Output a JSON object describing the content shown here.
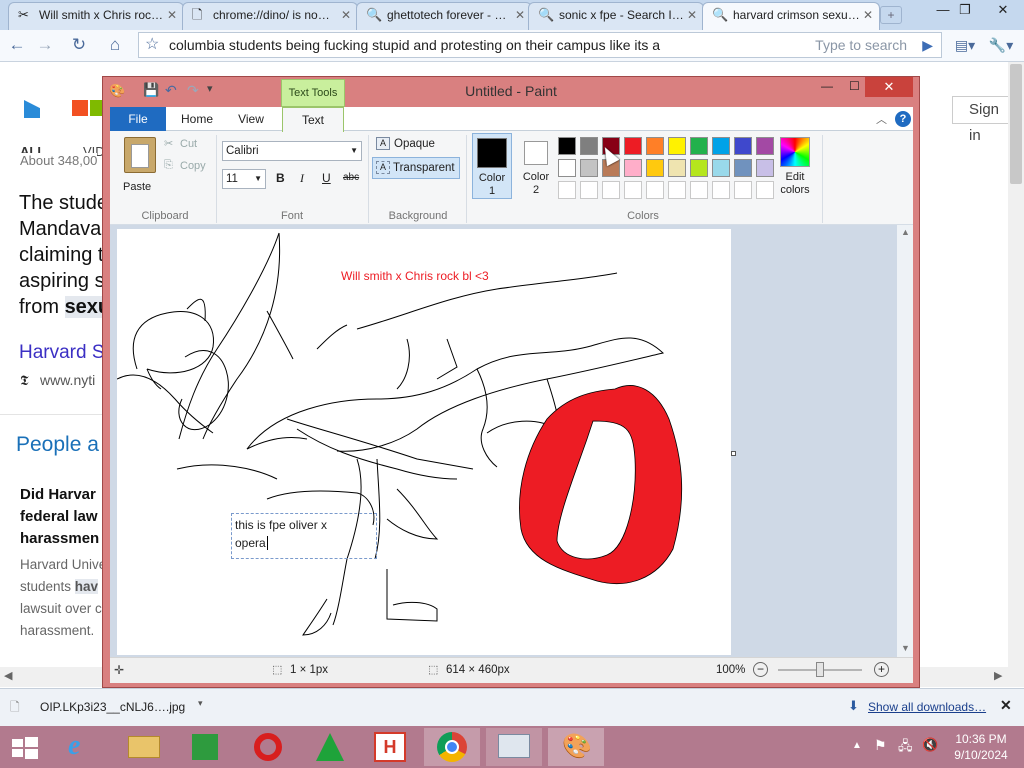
{
  "browser": {
    "tabs": [
      {
        "label": "Will smith x Chris roc…",
        "icon": "✂",
        "active": false
      },
      {
        "label": "chrome://dino/ is no…",
        "icon": "🗋",
        "active": false
      },
      {
        "label": "ghettotech forever - …",
        "icon": "🔍",
        "active": false
      },
      {
        "label": "sonic x fpe - Search I…",
        "icon": "🔍",
        "active": false
      },
      {
        "label": "harvard crimson sexu…",
        "icon": "🔍",
        "active": true
      }
    ],
    "address": "columbia students being fucking stupid and protesting on their campus like its a",
    "search_hint": "Type to search"
  },
  "page": {
    "tab_all": "ALL",
    "tab_vid": "VID",
    "result_count": "About 348,00",
    "sign_in": "Sign in",
    "snippet_lines": [
      "The stude",
      "Mandava",
      "claiming t",
      "aspiring s",
      "from "
    ],
    "snippet_bold": "sexu",
    "result_link": "Harvard S",
    "result_url": "www.nyti",
    "result_source_icon": "𝕿",
    "section_heading": "People a",
    "qa_title_lines": [
      "Did Harvar",
      "federal law",
      "harassmen"
    ],
    "qa_body_lines": [
      "Harvard Unive",
      "students ",
      "lawsuit over c",
      "harassment."
    ],
    "qa_highlight": "hav"
  },
  "paint": {
    "title": "Untitled - Paint",
    "context_tab": "Text Tools",
    "tabs": {
      "file": "File",
      "home": "Home",
      "view": "View",
      "text": "Text"
    },
    "clipboard": {
      "paste": "Paste",
      "cut": "Cut",
      "copy": "Copy",
      "group": "Clipboard"
    },
    "font": {
      "name": "Calibri",
      "size": "11",
      "bold": "B",
      "italic": "I",
      "underline": "U",
      "strike": "abc",
      "group": "Font"
    },
    "background": {
      "opaque": "Opaque",
      "transparent": "Transparent",
      "group": "Background"
    },
    "colors": {
      "color1_label": "Color 1",
      "color1_line1": "Color",
      "color1_line2": "1",
      "color2_label": "Color 2",
      "color2_line1": "Color",
      "color2_line2": "2",
      "edit_line1": "Edit",
      "edit_line2": "colors",
      "group": "Colors",
      "color1": "#000000",
      "color2": "#ffffff",
      "palette_row1": [
        "#000000",
        "#7f7f7f",
        "#880015",
        "#ed1c24",
        "#ff7f27",
        "#fff200",
        "#22b14c",
        "#00a2e8",
        "#3f48cc",
        "#a349a4"
      ],
      "palette_row2": [
        "#ffffff",
        "#c3c3c3",
        "#b97a57",
        "#ffaec9",
        "#ffc90e",
        "#efe4b0",
        "#b5e61d",
        "#99d9ea",
        "#7092be",
        "#c8bfe7"
      ],
      "palette_row3": [
        "#ffffff",
        "#ffffff",
        "#ffffff",
        "#ffffff",
        "#ffffff",
        "#ffffff",
        "#ffffff",
        "#ffffff",
        "#ffffff",
        "#ffffff"
      ]
    },
    "canvas": {
      "red_text": "Will smith x Chris rock bl <3",
      "textbox_line1": "this is fpe oliver x",
      "textbox_line2": "opera"
    },
    "status": {
      "cursor": "1 × 1px",
      "size": "614 × 460px",
      "zoom": "100%"
    }
  },
  "downloads": {
    "file": "OIP.LKp3i23__cNLJ6….jpg",
    "show_all": "Show all downloads…"
  },
  "taskbar": {
    "time": "10:36 PM",
    "date": "9/10/2024"
  }
}
